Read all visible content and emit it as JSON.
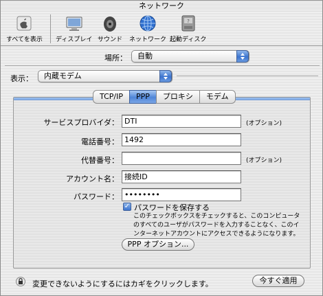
{
  "window": {
    "title": "ネットワーク"
  },
  "toolbar": {
    "items": [
      {
        "label": "すべてを表示",
        "icon": "apple-grid-icon"
      },
      {
        "label": "ディスプレイ",
        "icon": "display-icon"
      },
      {
        "label": "サウンド",
        "icon": "speaker-icon"
      },
      {
        "label": "ネットワーク",
        "icon": "globe-icon"
      },
      {
        "label": "起動ディスク",
        "icon": "disk-icon"
      }
    ]
  },
  "location": {
    "label": "場所：",
    "value": "自動"
  },
  "show": {
    "label": "表示：",
    "value": "内蔵モデム"
  },
  "tabs": [
    {
      "label": "TCP/IP",
      "active": false
    },
    {
      "label": "PPP",
      "active": true
    },
    {
      "label": "プロキシ",
      "active": false
    },
    {
      "label": "モデム",
      "active": false
    }
  ],
  "form": {
    "service_provider": {
      "label": "サービスプロバイダ：",
      "value": "DTI",
      "hint": "(オプション)"
    },
    "phone": {
      "label": "電話番号：",
      "value": "1492"
    },
    "alt_phone": {
      "label": "代替番号：",
      "value": "",
      "hint": "(オプション)"
    },
    "account": {
      "label": "アカウント名：",
      "value": "接続ID"
    },
    "password": {
      "label": "パスワード：",
      "value": "••••••••"
    },
    "save_password": {
      "label": "パスワードを保存する",
      "checked": true,
      "help": "このチェックボックスをチェックすると、このコンピュータのすべてのユーザがパスワードを入力することなく、このインターネットアカウントにアクセスできるようになります。"
    },
    "ppp_options_button": "PPP オプション..."
  },
  "footer": {
    "lock_text": "変更できないようにするにはカギをクリックします。",
    "apply_button": "今すぐ適用"
  },
  "colors": {
    "accent": "#3c74cf",
    "tab_active": "#4f86d8"
  }
}
